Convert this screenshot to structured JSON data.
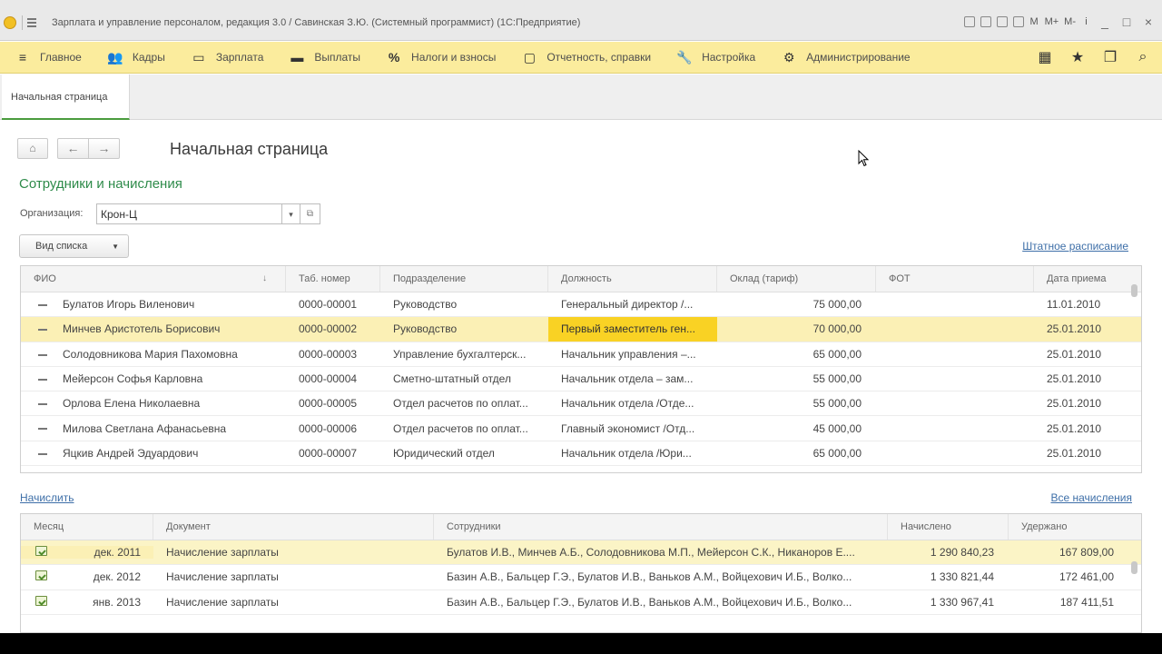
{
  "window": {
    "title": "Зарплата и управление персоналом, редакция 3.0 / Савинская З.Ю. (Системный программист)  (1С:Предприятие)",
    "right_tools": [
      "М",
      "М+",
      "М-",
      "i",
      "_",
      "□",
      "×"
    ]
  },
  "sections": [
    {
      "label": "Главное",
      "icon": "≡"
    },
    {
      "label": "Кадры",
      "icon": "👥"
    },
    {
      "label": "Зарплата",
      "icon": "▭"
    },
    {
      "label": "Выплаты",
      "icon": "▬"
    },
    {
      "label": "Налоги и взносы",
      "icon": "%"
    },
    {
      "label": "Отчетность, справки",
      "icon": "▢"
    },
    {
      "label": "Настройка",
      "icon": "🔧"
    },
    {
      "label": "Администрирование",
      "icon": "⚙"
    }
  ],
  "tabs": {
    "active": "Начальная страница"
  },
  "page": {
    "title": "Начальная страница"
  },
  "group": {
    "title": "Сотрудники и начисления"
  },
  "org": {
    "label": "Организация:",
    "value": "Крон-Ц"
  },
  "view_button": "Вид списка",
  "staff_link": "Штатное расписание",
  "employees": {
    "columns": [
      "ФИО",
      "Таб. номер",
      "Подразделение",
      "Должность",
      "Оклад (тариф)",
      "ФОТ",
      "Дата приема"
    ],
    "rows": [
      {
        "name": "Булатов Игорь Виленович",
        "tab": "0000-00001",
        "dept": "Руководство",
        "pos": "Генеральный директор /...",
        "salary": "75 000,00",
        "fot": "",
        "date": "11.01.2010"
      },
      {
        "name": "Минчев Аристотель Борисович",
        "tab": "0000-00002",
        "dept": "Руководство",
        "pos": "Первый заместитель ген...",
        "salary": "70 000,00",
        "fot": "",
        "date": "25.01.2010"
      },
      {
        "name": "Солодовникова Мария Пахомовна",
        "tab": "0000-00003",
        "dept": "Управление бухгалтерск...",
        "pos": "Начальник управления –...",
        "salary": "65 000,00",
        "fot": "",
        "date": "25.01.2010"
      },
      {
        "name": "Мейерсон Софья Карловна",
        "tab": "0000-00004",
        "dept": "Сметно-штатный отдел",
        "pos": "Начальник отдела – зам...",
        "salary": "55 000,00",
        "fot": "",
        "date": "25.01.2010"
      },
      {
        "name": "Орлова Елена Николаевна",
        "tab": "0000-00005",
        "dept": "Отдел расчетов по оплат...",
        "pos": "Начальник отдела /Отде...",
        "salary": "55 000,00",
        "fot": "",
        "date": "25.01.2010"
      },
      {
        "name": "Милова Светлана Афанасьевна",
        "tab": "0000-00006",
        "dept": "Отдел расчетов по оплат...",
        "pos": "Главный экономист /Отд...",
        "salary": "45 000,00",
        "fot": "",
        "date": "25.01.2010"
      },
      {
        "name": "Яцкив Андрей Эдуардович",
        "tab": "0000-00007",
        "dept": "Юридический отдел",
        "pos": "Начальник отдела /Юри...",
        "salary": "65 000,00",
        "fot": "",
        "date": "25.01.2010"
      }
    ]
  },
  "calc_link": "Начислить",
  "all_link": "Все начисления",
  "accruals": {
    "columns": [
      "Месяц",
      "Документ",
      "Сотрудники",
      "Начислено",
      "Удержано"
    ],
    "rows": [
      {
        "month": "дек. 2011",
        "doc": "Начисление зарплаты",
        "emps": "Булатов И.В., Минчев А.Б., Солодовникова М.П., Мейерсон С.К., Никаноров Е....",
        "accrued": "1 290 840,23",
        "withheld": "167 809,00"
      },
      {
        "month": "дек. 2012",
        "doc": "Начисление зарплаты",
        "emps": "Базин А.В., Бальцер Г.Э., Булатов И.В., Ваньков А.М., Войцехович И.Б., Волко...",
        "accrued": "1 330 821,44",
        "withheld": "172 461,00"
      },
      {
        "month": "янв. 2013",
        "doc": "Начисление зарплаты",
        "emps": "Базин А.В., Бальцер Г.Э., Булатов И.В., Ваньков А.М., Войцехович И.Б., Волко...",
        "accrued": "1 330 967,41",
        "withheld": "187 411,51"
      }
    ]
  }
}
